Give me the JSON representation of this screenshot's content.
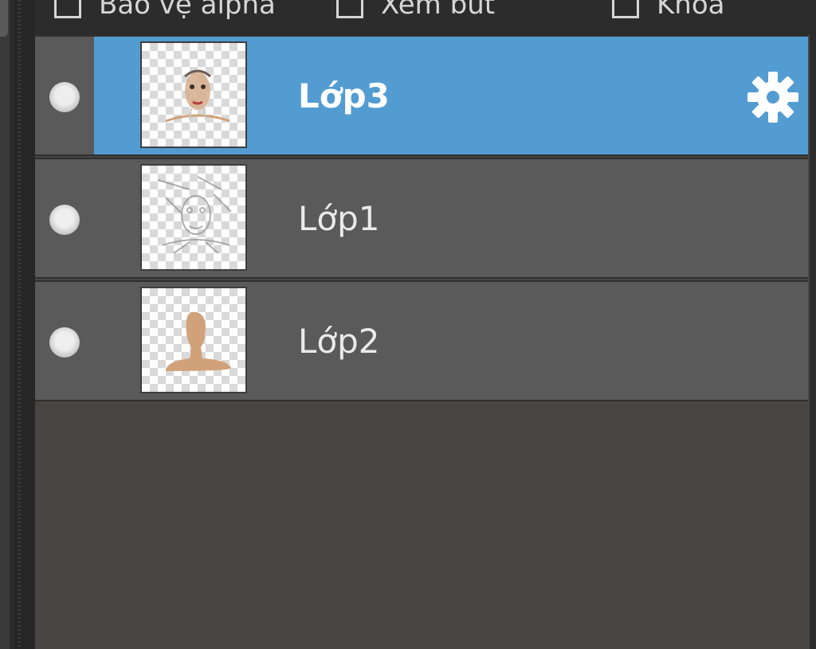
{
  "options_bar": {
    "protect_alpha_label": "Bảo vệ alpha",
    "view_label": "Xem bút",
    "lock_label": "Khóa"
  },
  "layers": [
    {
      "name": "Lớp3",
      "selected": true,
      "thumbnail": "face-sketch-colored",
      "settings_icon": "gear-icon"
    },
    {
      "name": "Lớp1",
      "selected": false,
      "thumbnail": "face-sketch-lines"
    },
    {
      "name": "Lớp2",
      "selected": false,
      "thumbnail": "skin-silhouette"
    }
  ],
  "colors": {
    "selected_row": "#529cd2",
    "row_bg": "#5a5a5a",
    "panel_bg": "#474644",
    "skin": "#d1a27a"
  }
}
